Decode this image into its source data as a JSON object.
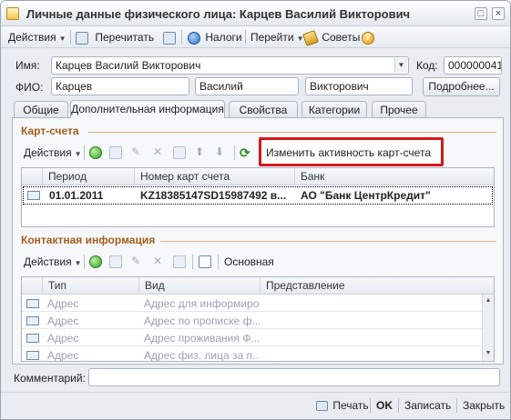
{
  "window": {
    "title": "Личные данные физического лица: Карцев Василий Викторович",
    "controls": [
      "□",
      "×"
    ]
  },
  "toolbar": {
    "actions": "Действия",
    "reread": "Перечитать",
    "taxes": "Налоги",
    "goto": "Перейти",
    "tips": "Советы"
  },
  "form": {
    "name_label": "Имя:",
    "name_value": "Карцев Василий Викторович",
    "code_label": "Код:",
    "code_value": "000000041",
    "fio_label": "ФИО:",
    "last_name": "Карцев",
    "first_name": "Василий",
    "middle_name": "Викторович",
    "more_button": "Подробнее..."
  },
  "tabs": [
    "Общие",
    "Дополнительная информация",
    "Свойства",
    "Категории",
    "Прочее"
  ],
  "cards": {
    "title": "Карт-счета",
    "actions": "Действия",
    "highlight_button": "Изменить активность карт-счета",
    "columns": [
      "Период",
      "Номер карт счета",
      "Банк"
    ],
    "rows": [
      {
        "period": "01.01.2011",
        "number": "KZ18385147SD15987492 в...",
        "bank": "АО \"Банк ЦентрКредит\""
      }
    ]
  },
  "contacts": {
    "title": "Контактная информация",
    "actions": "Действия",
    "main_button": "Основная",
    "columns": [
      "Тип",
      "Вид",
      "Представление"
    ],
    "rows": [
      {
        "type": "Адрес",
        "kind": "Адрес для информиро...",
        "view": ""
      },
      {
        "type": "Адрес",
        "kind": "Адрес по прописке ф...",
        "view": ""
      },
      {
        "type": "Адрес",
        "kind": "Адрес проживания Ф...",
        "view": ""
      },
      {
        "type": "Адрес",
        "kind": "Адрес физ. лица за п...",
        "view": ""
      }
    ]
  },
  "comment": {
    "label": "Комментарий:",
    "value": ""
  },
  "footer": {
    "print": "Печать",
    "ok": "OK",
    "save": "Записать",
    "close": "Закрыть"
  },
  "colors": {
    "section_title": "#a35f1c",
    "highlight_border": "#d5191d",
    "selection": "#000000"
  }
}
